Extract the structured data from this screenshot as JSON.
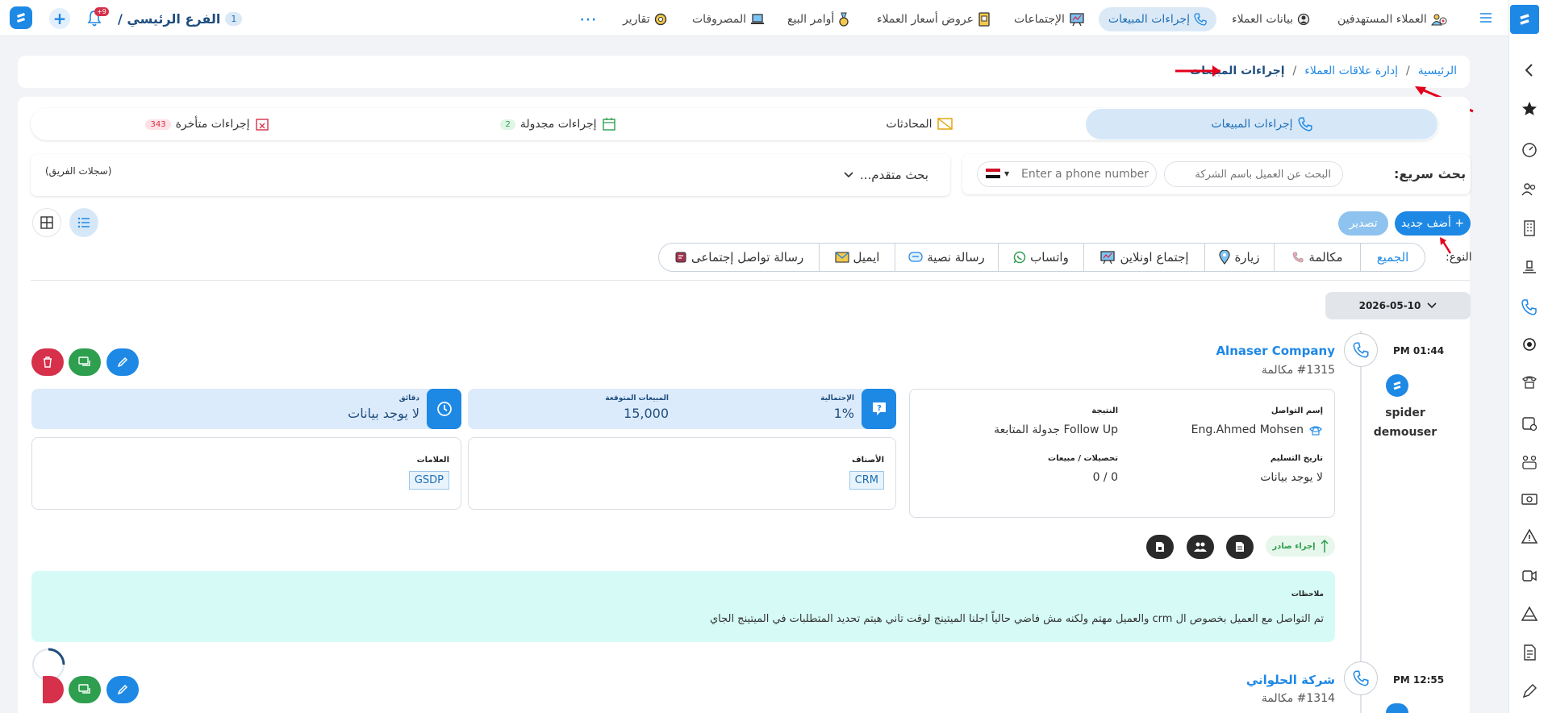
{
  "topbar": {
    "branch_count": "1",
    "branch_label": "الفرع الرئيسي /",
    "notif_count": "+9",
    "nav": [
      {
        "label": "العملاء المستهدفين",
        "icon": "target-users-icon"
      },
      {
        "label": "بيانات العملاء",
        "icon": "customer-data-icon"
      },
      {
        "label": "إجراءات المبيعات",
        "icon": "phone-icon"
      },
      {
        "label": "الإجتماعات",
        "icon": "meeting-board-icon"
      },
      {
        "label": "عروض أسعار العملاء",
        "icon": "price-quote-icon"
      },
      {
        "label": "أوامر البيع",
        "icon": "sales-order-icon"
      },
      {
        "label": "المصروفات",
        "icon": "laptop-expenses-icon"
      },
      {
        "label": "تقارير",
        "icon": "reports-icon"
      }
    ],
    "more": "⋯"
  },
  "breadcrumb": {
    "home": "الرئيسية",
    "sep": "/",
    "crm": "إدارة علاقات العملاء",
    "current": "إجراءات المبيعات"
  },
  "tabs": [
    {
      "label": "إجراءات المبيعات",
      "badge": ""
    },
    {
      "label": "المحادثات",
      "badge": ""
    },
    {
      "label": "إجراءات مجدولة",
      "badge": "2"
    },
    {
      "label": "إجراءات متأخرة",
      "badge": "343"
    }
  ],
  "search": {
    "quick_label": "بحث سريع:",
    "customer_placeholder": "البحث عن العميل باسم الشركة",
    "phone_placeholder": "Enter a phone number",
    "advanced": "بحث متقدم...",
    "team_records": "(سجلات الفريق)"
  },
  "actions": {
    "add_new": "+ أضف جديد",
    "export": "تصدير"
  },
  "type_filter": {
    "label": "النوع:",
    "options": [
      "الجميع",
      "مكالمة",
      "زيارة",
      "إجتماع اونلاين",
      "واتساب",
      "رسالة نصية",
      "ايميل",
      "رسالة تواصل إجتماعى"
    ]
  },
  "date_group": "2026-05-10",
  "entries": [
    {
      "time": "PM 01:44",
      "user": "spider demouser",
      "company": "Alnaser Company",
      "number": "#1315 مكالمة",
      "contact_label": "إسم التواصل",
      "contact_value": "Eng.Ahmed Mohsen",
      "result_label": "النتيجة",
      "result_value": "Follow Up جدولة المتابعة",
      "delivery_label": "تاريخ التسليم",
      "delivery_value": "لا يوجد بيانات",
      "collections_label": "تحصيلات / مبيعات",
      "collections_value": "0 / 0",
      "prob_label": "الإحتمالية",
      "prob_value": "1%",
      "sales_label": "المبيعات المتوقعة",
      "sales_value": "15,000",
      "minutes_label": "دقائق",
      "minutes_value": "لا يوجد بيانات",
      "categories_label": "الأصناف",
      "categories_value": "CRM",
      "tags_label": "العلامات",
      "tags_value": "GSDP",
      "direction_label": "إجراء صادر",
      "notes_label": "ملاحظات",
      "notes_text": "تم التواصل مع العميل بخصوص ال crm والعميل مهتم ولكنه مش فاضي حالياً اجلنا الميتينج لوقت تاني هيتم تحديد المتطلبات في الميتينج الجاي"
    },
    {
      "time": "PM 12:55",
      "company": "شركة الحلواني",
      "number": "#1314 مكالمة"
    }
  ],
  "colors": {
    "primary": "#1e88e5",
    "green": "#2e9e4f",
    "red": "#d6304a",
    "light_blue": "#dcebfb",
    "notes_bg": "#d6fbf6"
  }
}
